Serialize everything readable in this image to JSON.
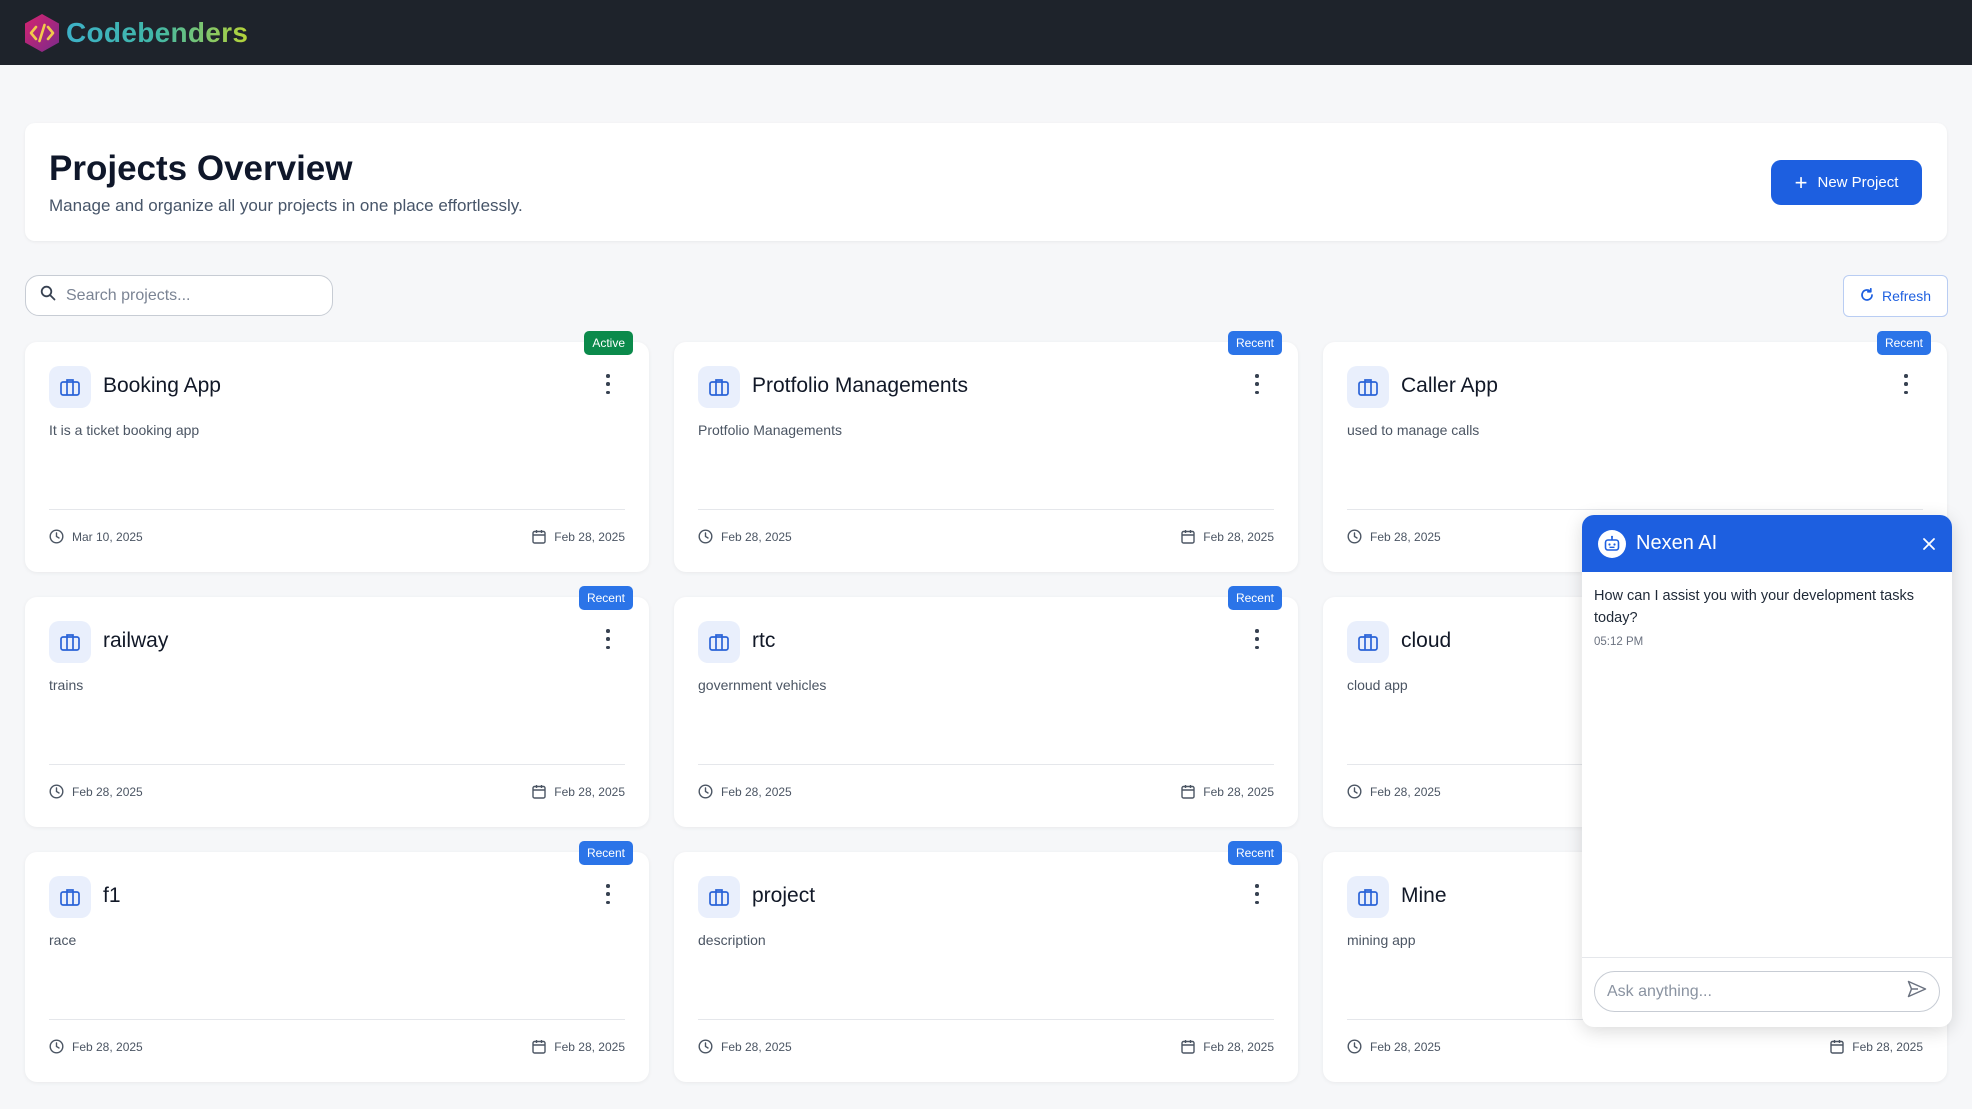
{
  "app": {
    "name": "Codebenders"
  },
  "header": {
    "title": "Projects Overview",
    "subtitle": "Manage and organize all your projects in one place effortlessly.",
    "new_project_label": "New Project"
  },
  "search": {
    "placeholder": "Search projects..."
  },
  "refresh_label": "Refresh",
  "projects": [
    {
      "name": "Booking App",
      "description": "It is a ticket booking app",
      "badge": "Active",
      "updated": "Mar 10, 2025",
      "created": "Feb 28, 2025"
    },
    {
      "name": "Protfolio Managements",
      "description": "Protfolio Managements",
      "badge": "Recent",
      "updated": "Feb 28, 2025",
      "created": "Feb 28, 2025"
    },
    {
      "name": "Caller App",
      "description": "used to manage calls",
      "badge": "Recent",
      "updated": "Feb 28, 2025",
      "created": ""
    },
    {
      "name": "railway",
      "description": "trains",
      "badge": "Recent",
      "updated": "Feb 28, 2025",
      "created": "Feb 28, 2025"
    },
    {
      "name": "rtc",
      "description": "government vehicles",
      "badge": "Recent",
      "updated": "Feb 28, 2025",
      "created": "Feb 28, 2025"
    },
    {
      "name": "cloud",
      "description": "cloud app",
      "badge": "",
      "updated": "Feb 28, 2025",
      "created": ""
    },
    {
      "name": "f1",
      "description": "race",
      "badge": "Recent",
      "updated": "Feb 28, 2025",
      "created": "Feb 28, 2025"
    },
    {
      "name": "project",
      "description": "description",
      "badge": "Recent",
      "updated": "Feb 28, 2025",
      "created": "Feb 28, 2025"
    },
    {
      "name": "Mine",
      "description": "mining app",
      "badge": "",
      "updated": "Feb 28, 2025",
      "created": "Feb 28, 2025"
    }
  ],
  "chat": {
    "title": "Nexen AI",
    "message": "How can I assist you with your development tasks today?",
    "time": "05:12 PM",
    "input_placeholder": "Ask anything..."
  },
  "colors": {
    "primary": "#1d5fe0",
    "active_badge": "#0b8a4b",
    "recent_badge": "#2b74e8",
    "topbar": "#1e232b"
  },
  "icons": {
    "logo": "code-hexagon-icon",
    "project": "briefcase-icon",
    "updated": "clock-icon",
    "created": "calendar-icon",
    "chat_bot": "robot-icon"
  }
}
